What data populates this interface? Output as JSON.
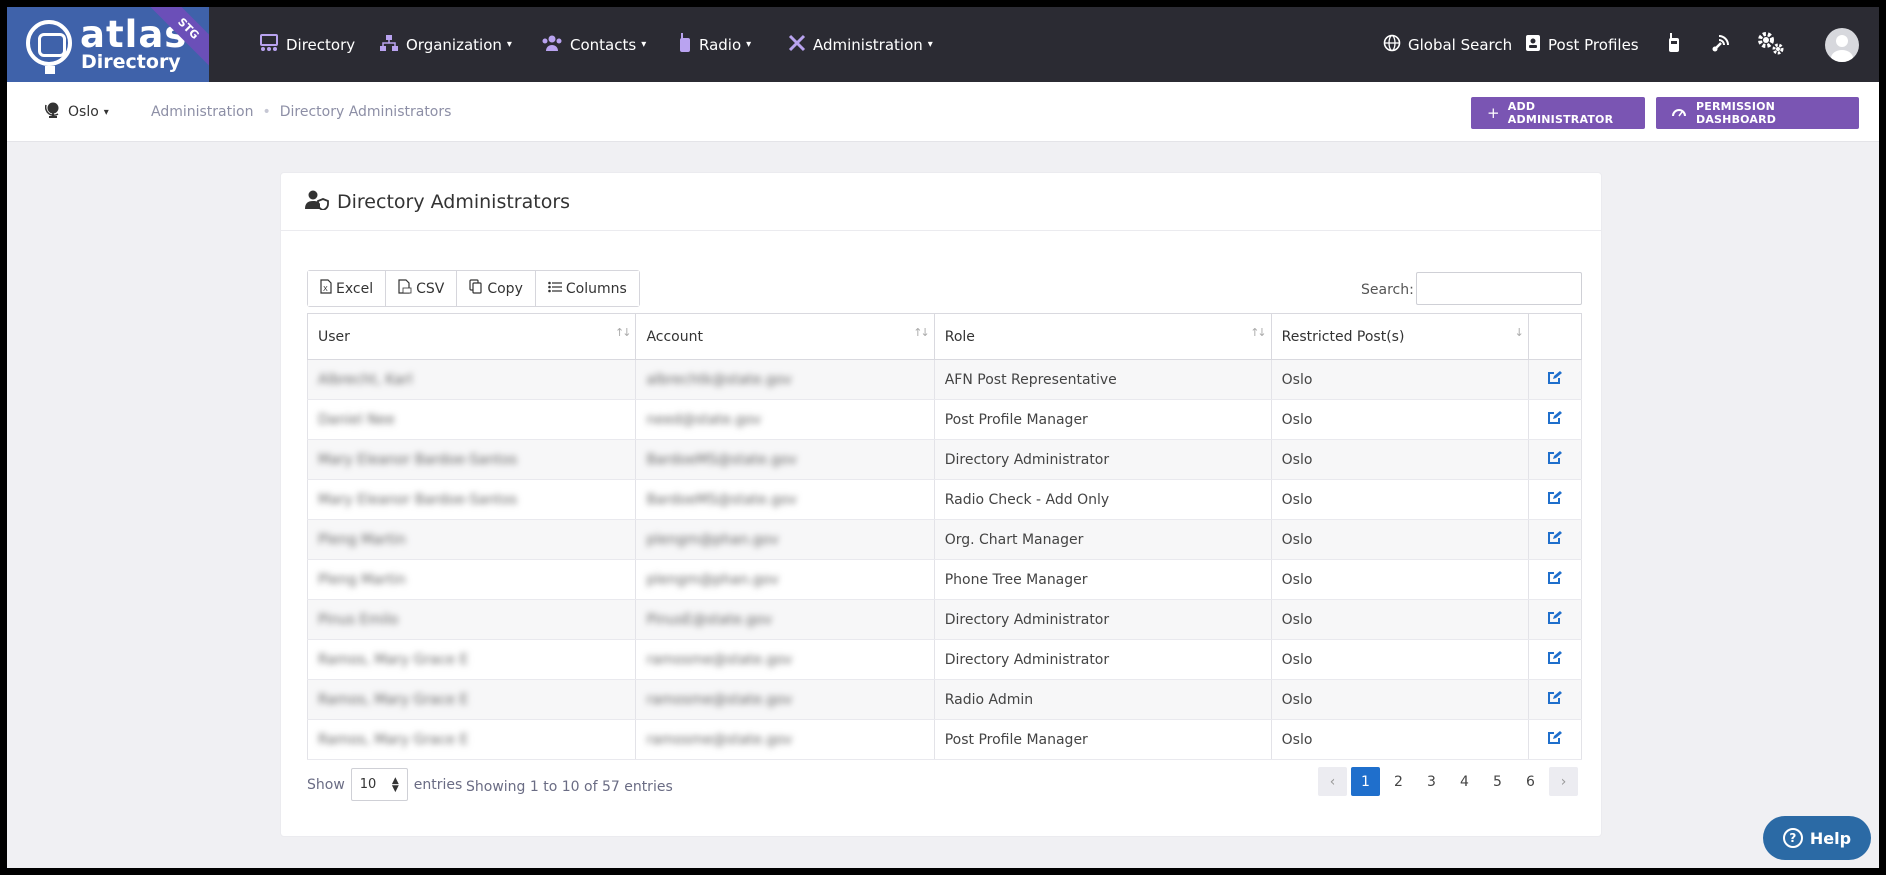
{
  "brand": {
    "word1": "atlas",
    "word2": "Directory",
    "badge": "STG"
  },
  "nav": {
    "items": [
      {
        "label": "Directory",
        "icon": "directory-icon",
        "dropdown": false
      },
      {
        "label": "Organization",
        "icon": "org-chart-icon",
        "dropdown": true
      },
      {
        "label": "Contacts",
        "icon": "contacts-icon",
        "dropdown": true
      },
      {
        "label": "Radio",
        "icon": "radio-icon",
        "dropdown": true
      },
      {
        "label": "Administration",
        "icon": "tools-icon",
        "dropdown": true
      }
    ],
    "global_search": "Global Search",
    "post_profiles": "Post Profiles"
  },
  "subbar": {
    "post": "Oslo",
    "breadcrumb": [
      "Administration",
      "Directory Administrators"
    ],
    "add_button": "ADD ADMINISTRATOR",
    "permission_button": "PERMISSION DASHBOARD"
  },
  "card": {
    "title": "Directory Administrators",
    "toolbar": [
      "Excel",
      "CSV",
      "Copy",
      "Columns"
    ],
    "search_label": "Search:",
    "search_value": "",
    "columns": [
      "User",
      "Account",
      "Role",
      "Restricted Post(s)"
    ],
    "rows": [
      {
        "user": "Albrecht, Karl",
        "account": "albrechtk@state.gov",
        "role": "AFN Post Representative",
        "post": "Oslo"
      },
      {
        "user": "Daniel Nee",
        "account": "need@state.gov",
        "role": "Post Profile Manager",
        "post": "Oslo"
      },
      {
        "user": "Mary Eleanor Bardoe-Santos",
        "account": "BardoeMS@state.gov",
        "role": "Directory Administrator",
        "post": "Oslo"
      },
      {
        "user": "Mary Eleanor Bardoe-Santos",
        "account": "BardoeMS@state.gov",
        "role": "Radio Check - Add Only",
        "post": "Oslo"
      },
      {
        "user": "Pleng Martin",
        "account": "plengm@phan.gov",
        "role": "Org. Chart Manager",
        "post": "Oslo"
      },
      {
        "user": "Pleng Martin",
        "account": "plengm@phan.gov",
        "role": "Phone Tree Manager",
        "post": "Oslo"
      },
      {
        "user": "Pinus Emilo",
        "account": "PinusE@state.gov",
        "role": "Directory Administrator",
        "post": "Oslo"
      },
      {
        "user": "Ramos, Mary Grace E",
        "account": "ramosme@state.gov",
        "role": "Directory Administrator",
        "post": "Oslo"
      },
      {
        "user": "Ramos, Mary Grace E",
        "account": "ramosme@state.gov",
        "role": "Radio Admin",
        "post": "Oslo"
      },
      {
        "user": "Ramos, Mary Grace E",
        "account": "ramosme@state.gov",
        "role": "Post Profile Manager",
        "post": "Oslo"
      }
    ],
    "show_label": "Show",
    "entries_value": "10",
    "entries_label": "entries",
    "info": "Showing 1 to 10 of 57 entries",
    "pages": [
      "1",
      "2",
      "3",
      "4",
      "5",
      "6"
    ],
    "active_page": "1"
  },
  "help_label": "Help",
  "colors": {
    "nav_bg": "#2b2b33",
    "accent_purple": "#7a55b3",
    "link_blue": "#1f6fcc",
    "help_blue": "#2b6aa5"
  }
}
